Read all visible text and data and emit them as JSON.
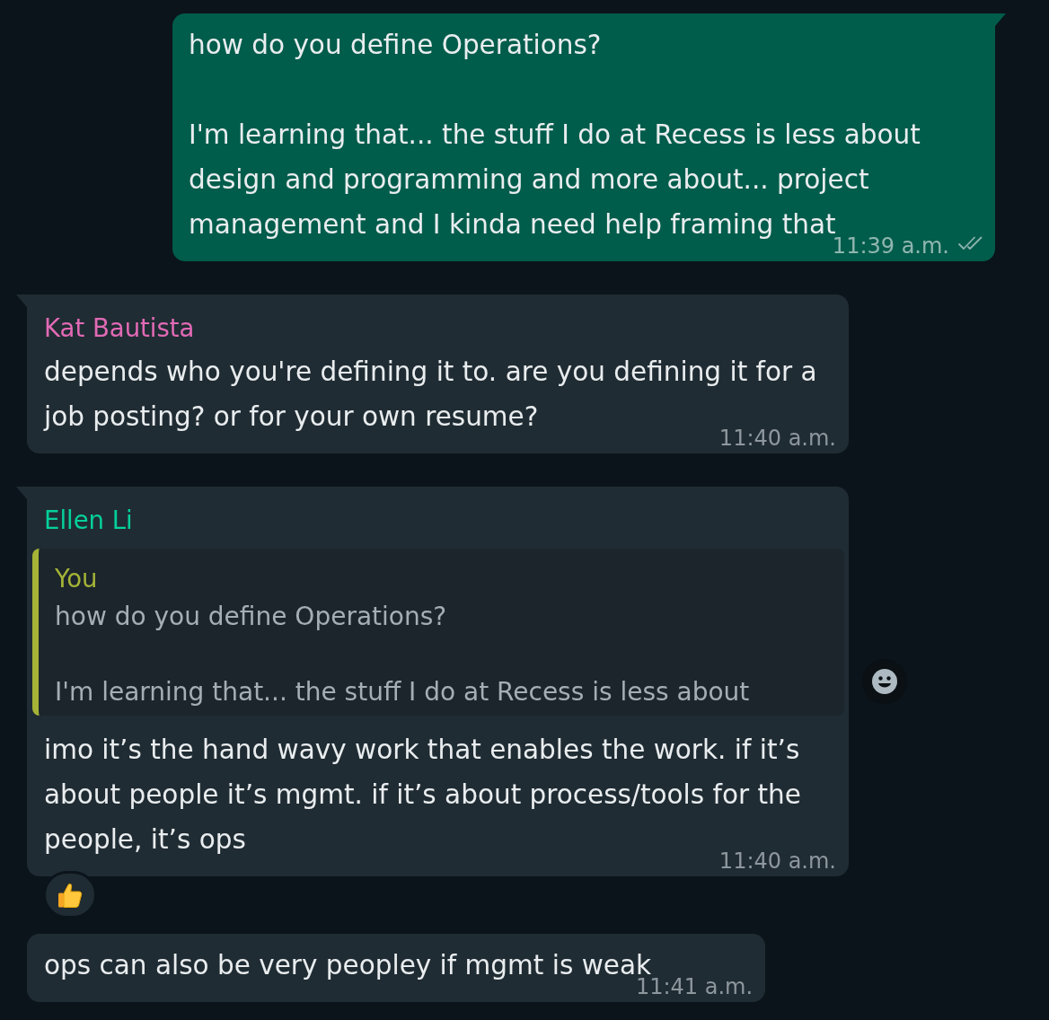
{
  "messages": [
    {
      "kind": "outgoing",
      "tail": true,
      "text": "how do you define Operations?\n\nI'm learning that... the stuff I do at Recess is less about design and programming and more about... project management and I kinda need help framing that",
      "time": "11:39 a.m.",
      "read": false
    },
    {
      "kind": "incoming",
      "tail": true,
      "sender": {
        "name": "Kat Bautista",
        "color": "#e26ab6"
      },
      "text": "depends who you're defining it to. are you defining it for a job posting? or for your own resume?",
      "time": "11:40 a.m."
    },
    {
      "kind": "incoming",
      "tail": true,
      "sender": {
        "name": "Ellen Li",
        "color": "#06cf9c"
      },
      "quote": {
        "author": "You",
        "color": "#a5b337",
        "text": "how do you define Operations?\n\nI'm learning that... the stuff I do at Recess is less about"
      },
      "text": "imo it’s the hand wavy work that enables the work. if it’s about people it’s mgmt. if it’s about process/tools for the people, it’s ops",
      "time": "11:40 a.m.",
      "react_button": true,
      "reactions": [
        {
          "kind": "thumbs_up"
        }
      ]
    },
    {
      "kind": "incoming",
      "tail": false,
      "text": "ops can also be very peopley if mgmt is weak",
      "time": "11:41 a.m."
    }
  ]
}
